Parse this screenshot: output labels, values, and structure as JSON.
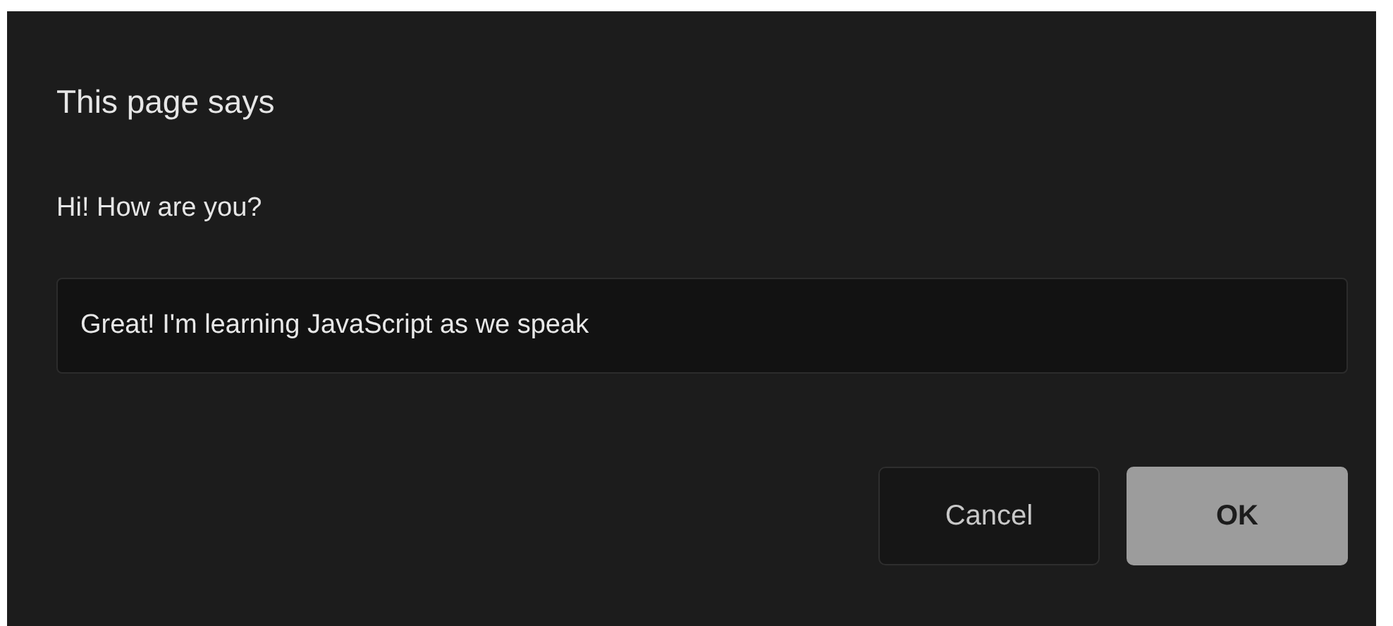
{
  "dialog": {
    "title": "This page says",
    "message": "Hi! How are you?",
    "input": {
      "value": "Great! I'm learning JavaScript as we speak"
    },
    "buttons": [
      {
        "label": "Cancel",
        "kind": "secondary"
      },
      {
        "label": "OK",
        "kind": "primary"
      }
    ]
  }
}
